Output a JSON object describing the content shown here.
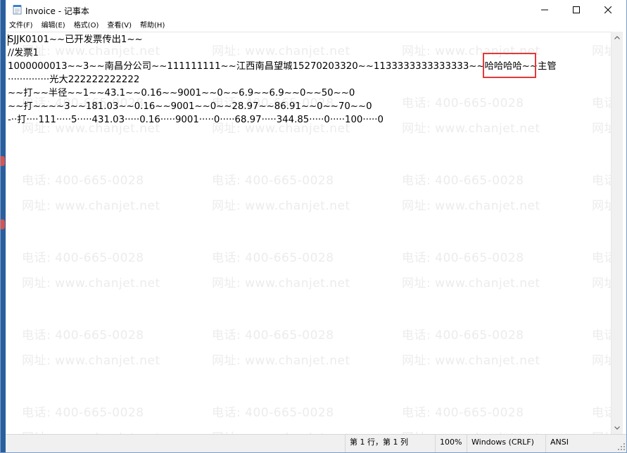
{
  "window": {
    "title": "Invoice - 记事本",
    "minimize_glyph": "—",
    "maximize_glyph": "☐",
    "close_glyph": "✕"
  },
  "menu": {
    "items": [
      {
        "label": "文件(F)"
      },
      {
        "label": "编辑(E)"
      },
      {
        "label": "格式(O)"
      },
      {
        "label": "查看(V)"
      },
      {
        "label": "帮助(H)"
      }
    ]
  },
  "editor": {
    "lines": [
      "SJJK0101~~已开发票传出1~~",
      "//发票1",
      "1000000013~~3~~南昌分公司~~111111111~~江西南昌望城15270203320~~1133333333333333~~哈哈哈哈~~主管",
      "··············光大222222222222",
      "~~打~~半径~~1~~43.1~~0.16~~9001~~0~~6.9~~6.9~~0~~50~~0",
      "~~打~~~~3~~181.03~~0.16~~9001~~0~~28.97~~86.91~~0~~70~~0",
      "-··打····111·····5·····431.03·····0.16·····9001·····0·····68.97·····344.85·····0·····100·····0"
    ],
    "watermark_line1": "电话: 400-665-0028",
    "watermark_line2": "网址: www.chanjet.net"
  },
  "statusbar": {
    "position": "第 1 行，第 1 列",
    "zoom": "100%",
    "line_ending": "Windows (CRLF)",
    "encoding": "ANSI"
  },
  "colors": {
    "highlight_border": "#e03a3a",
    "watermark": "#ececec",
    "desktop_strip": "#2a5f9e"
  }
}
